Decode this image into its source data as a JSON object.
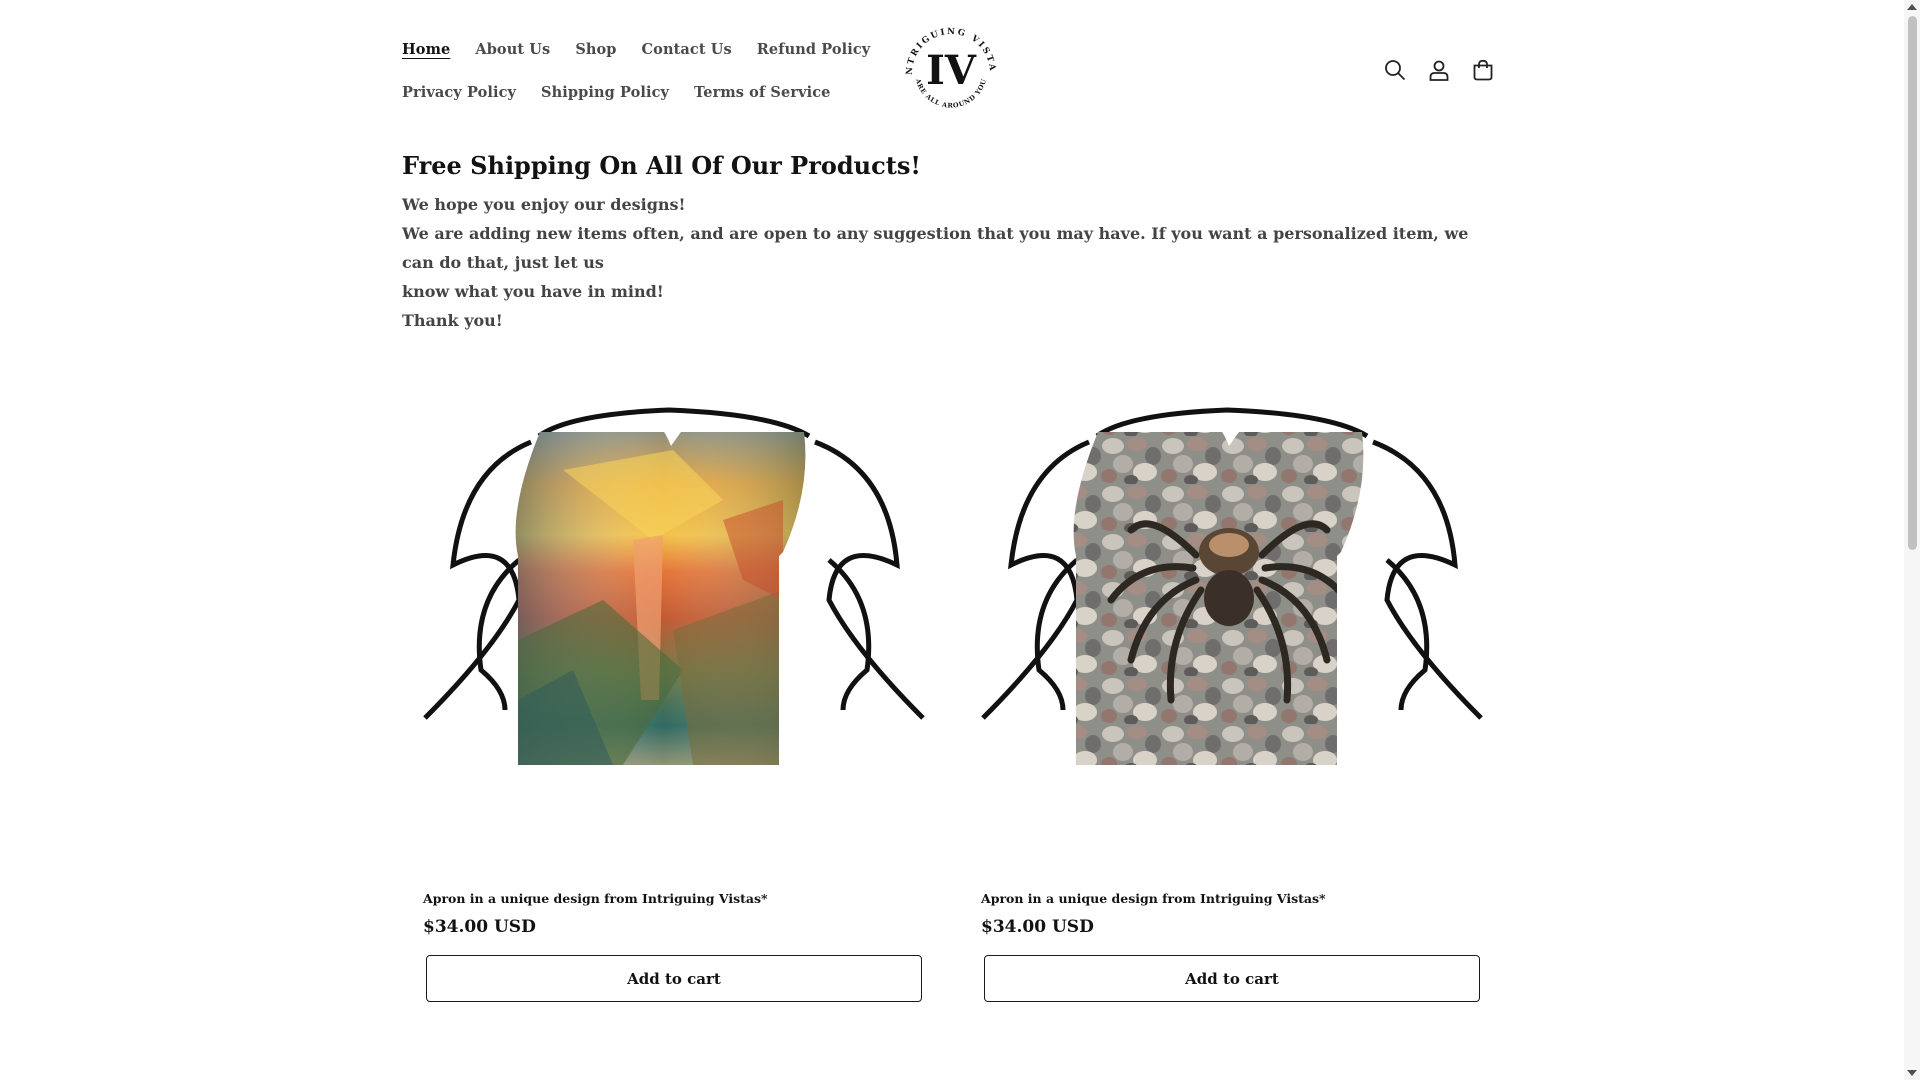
{
  "nav": {
    "row1": [
      "Home",
      "About Us",
      "Shop",
      "Contact Us",
      "Refund Policy"
    ],
    "row2": [
      "Privacy Policy",
      "Shipping Policy",
      "Terms of Service"
    ]
  },
  "logo": {
    "monogram": "IV",
    "ring_text_top": "INTRIGUING VISTAS",
    "ring_text_bottom": "ARE ALL AROUND YOU"
  },
  "header_icons": [
    "search-icon",
    "account-icon",
    "cart-icon"
  ],
  "intro": {
    "heading": "Free Shipping On All Of Our Products!",
    "line1": "We hope you enjoy our designs!",
    "line2": "We are adding new items often, and are open to any suggestion that you may have. If you want a personalized item, we can do that, just let us",
    "line3": "know what you have in mind!",
    "line4": "Thank you!"
  },
  "products": [
    {
      "title": "Apron in a unique design from Intriguing Vistas*",
      "price": "$34.00 USD",
      "button": "Add to cart",
      "image": "apron with sunset landscape print"
    },
    {
      "title": "Apron in a unique design from Intriguing Vistas*",
      "price": "$34.00 USD",
      "button": "Add to cart",
      "image": "apron with tarantula on pebbles print"
    }
  ],
  "colors": {
    "text": "#121212",
    "nav_text": "#4a4a4a",
    "background": "#ffffff",
    "button_border": "#1a1a1a"
  }
}
